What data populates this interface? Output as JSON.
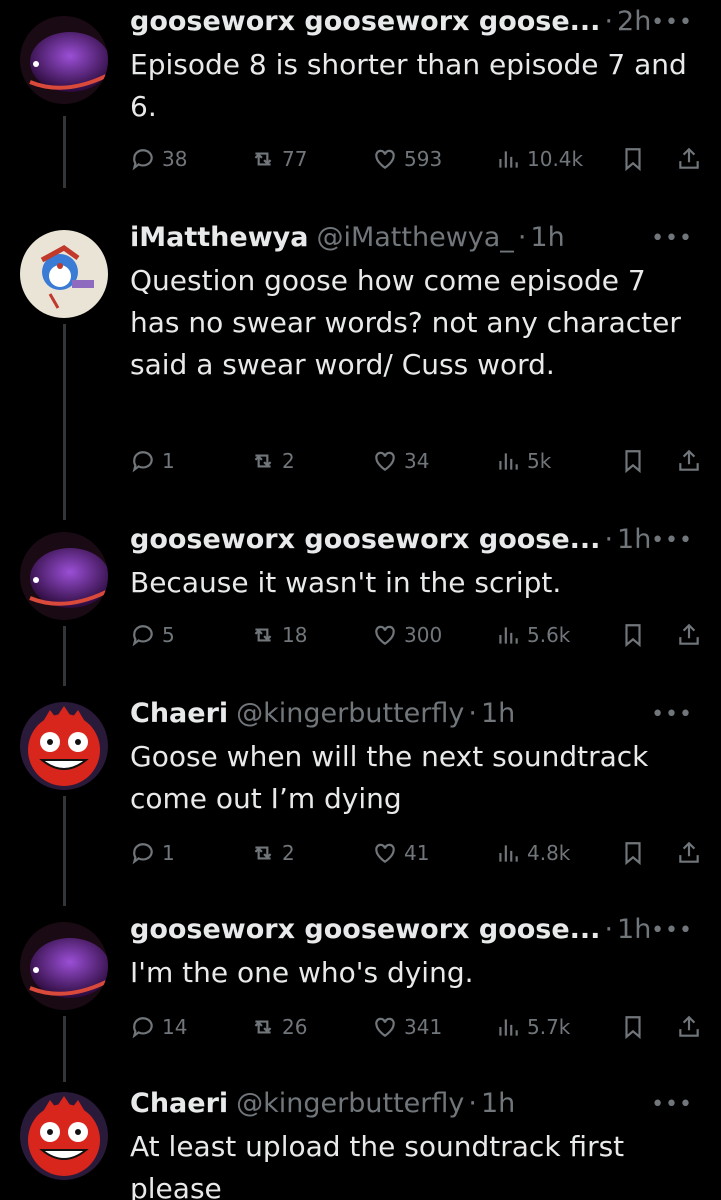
{
  "tweets": [
    {
      "name": "gooseworx gooseworx goose...",
      "handle": "",
      "time": "2h",
      "text": "Episode 8 is shorter than episode 7 and 6.",
      "avatar": "purple-creature",
      "replies": "38",
      "retweets": "77",
      "likes": "593",
      "views": "10.4k"
    },
    {
      "name": "iMatthewya",
      "handle": "@iMatthewya_",
      "time": "1h",
      "text": "Question goose how come episode 7 has no swear words? not any character said a swear word/ Cuss word.",
      "avatar": "drawing",
      "replies": "1",
      "retweets": "2",
      "likes": "34",
      "views": "5k"
    },
    {
      "name": "gooseworx gooseworx goose...",
      "handle": "",
      "time": "1h",
      "text": "Because it wasn't in the script.",
      "avatar": "purple-creature",
      "replies": "5",
      "retweets": "18",
      "likes": "300",
      "views": "5.6k"
    },
    {
      "name": "Chaeri",
      "handle": "@kingerbutterfly",
      "time": "1h",
      "text": "Goose when will the next soundtrack come out I’m dying",
      "avatar": "red-face",
      "replies": "1",
      "retweets": "2",
      "likes": "41",
      "views": "4.8k"
    },
    {
      "name": "gooseworx gooseworx goose...",
      "handle": "",
      "time": "1h",
      "text": "I'm the one who's dying.",
      "avatar": "purple-creature",
      "replies": "14",
      "retweets": "26",
      "likes": "341",
      "views": "5.7k"
    },
    {
      "name": "Chaeri",
      "handle": "@kingerbutterfly",
      "time": "1h",
      "text": "At least upload the soundtrack first please",
      "avatar": "red-face"
    }
  ],
  "icons": {
    "reply": "reply-icon",
    "retweet": "retweet-icon",
    "like": "heart-icon",
    "views": "views-icon",
    "bookmark": "bookmark-icon",
    "share": "share-icon",
    "more": "more-icon"
  },
  "colors": {
    "background": "#000000",
    "text": "#e7e9ea",
    "secondary": "#71767b",
    "thread_line": "#333639"
  }
}
